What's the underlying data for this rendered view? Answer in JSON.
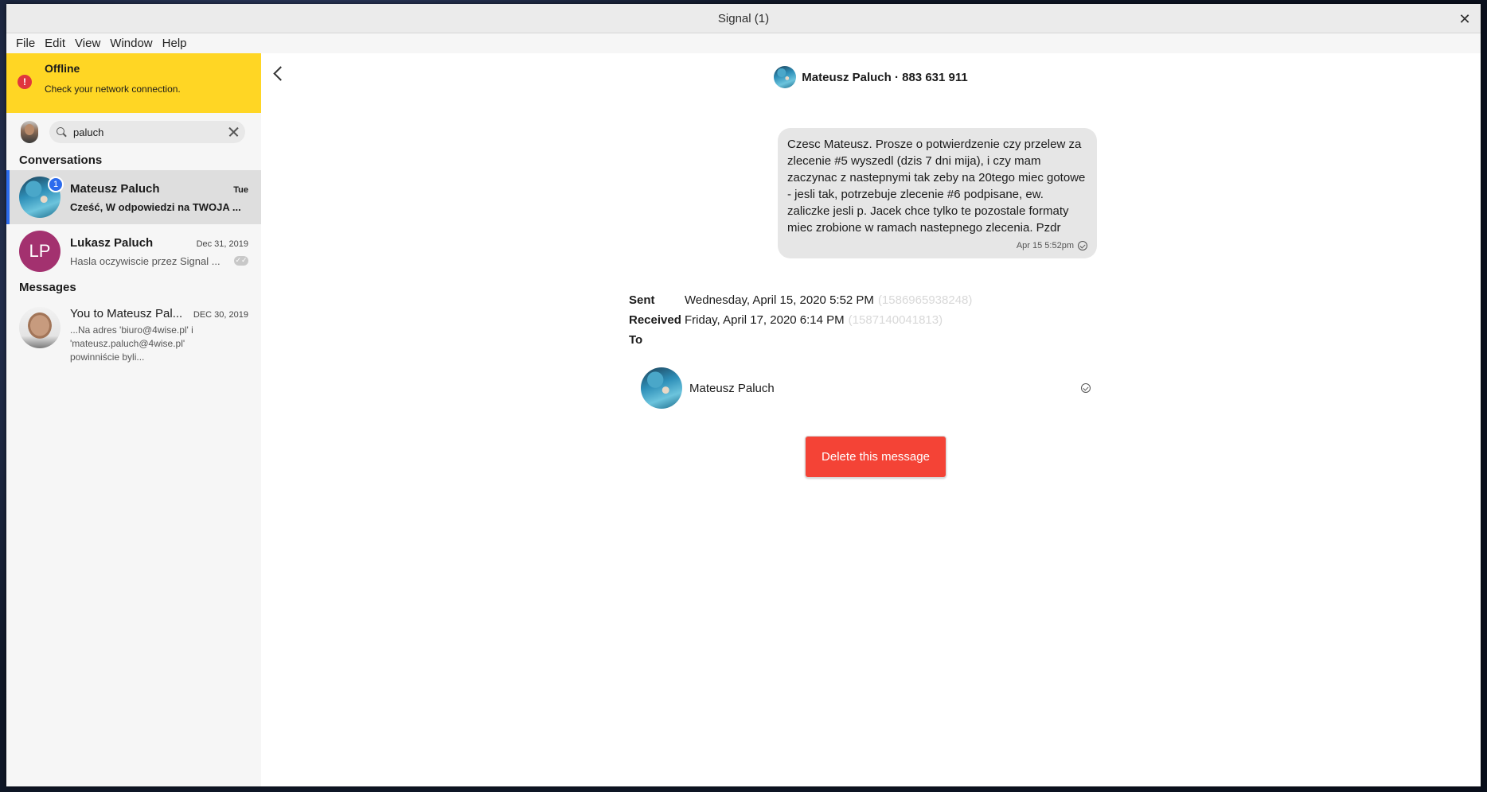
{
  "window": {
    "title": "Signal (1)",
    "close_glyph": "✕"
  },
  "menu": [
    "File",
    "Edit",
    "View",
    "Window",
    "Help"
  ],
  "offline": {
    "title": "Offline",
    "subtitle": "Check your network connection.",
    "icon": "!"
  },
  "search": {
    "value": "paluch",
    "placeholder": "Search"
  },
  "sections": {
    "conversations": "Conversations",
    "messages": "Messages"
  },
  "conversations": [
    {
      "name": "Mateusz Paluch",
      "date": "Tue",
      "preview": "Cześć, W odpowiedzi na TWOJA ...",
      "unread": "1"
    },
    {
      "name": "Lukasz Paluch",
      "initials": "LP",
      "date": "Dec 31, 2019",
      "preview": "Hasla oczywiscie przez Signal ..."
    }
  ],
  "message_results": [
    {
      "name": "You to Mateusz Pal...",
      "date": "DEC 30, 2019",
      "preview": "...Na adres 'biuro@4wise.pl' i\n'mateusz.paluch@4wise.pl'\npowinniście byli..."
    }
  ],
  "header": {
    "title": "Mateusz Paluch · 883 631 911"
  },
  "message": {
    "text": "Czesc Mateusz. Prosze o potwierdzenie czy przelew za zlecenie #5 wyszedl (dzis 7 dni mija), i czy mam zaczynac z nastepnymi tak zeby na 20tego miec gotowe - jesli tak, potrzebuje zlecenie #6 podpisane, ew. zaliczke jesli p. Jacek chce tylko te pozostale formaty miec zrobione w ramach nastepnego zlecenia. Pzdr",
    "time": "Apr 15 5:52pm"
  },
  "details": {
    "sent_label": "Sent",
    "sent_value": "Wednesday, April 15, 2020 5:52 PM",
    "sent_ts": "(1586965938248)",
    "received_label": "Received",
    "received_value": "Friday, April 17, 2020 6:14 PM",
    "received_ts": "(1587140041813)",
    "to_label": "To"
  },
  "recipient": {
    "name": "Mateusz Paluch"
  },
  "delete_button": "Delete this message",
  "colors": {
    "offline_banner": "#ffd624",
    "accent": "#2c6bed",
    "delete": "#f44336",
    "lp_avatar": "#a3316f"
  }
}
